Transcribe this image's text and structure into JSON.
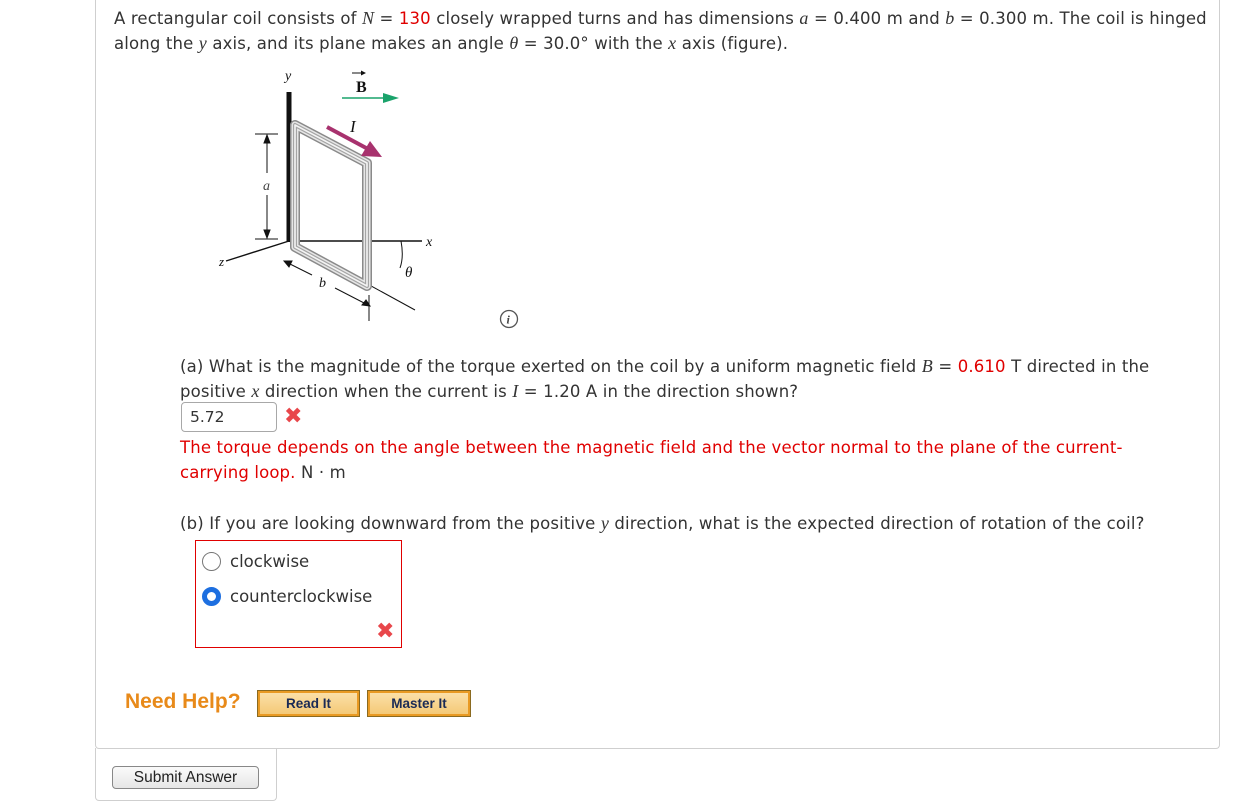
{
  "problem": {
    "intro_1": "A rectangular coil consists of ",
    "N_var": "N",
    "eq": " = ",
    "N_value": "130",
    "intro_2": " closely wrapped turns and has dimensions ",
    "a_var": "a",
    "a_value": " = 0.400 m and ",
    "b_var": "b",
    "b_value": " = 0.300 m. The coil is hinged",
    "intro_3": "along the ",
    "y_var": "y",
    "intro_4": " axis, and its plane makes an angle ",
    "theta_var": "θ",
    "theta_value": " = 30.0° with the ",
    "x_var": "x",
    "intro_5": " axis (figure)."
  },
  "figure": {
    "label_y": "y",
    "label_B": "B",
    "label_I": "I",
    "label_a": "a",
    "label_z": "z",
    "label_b": "b",
    "label_x": "x",
    "label_theta": "θ",
    "info_icon": "info-icon"
  },
  "part_a": {
    "q1": "(a) What is the magnitude of the torque exerted on the coil by a uniform magnetic field ",
    "B_var": "B",
    "eq": " = ",
    "B_value": "0.610",
    "q2": " T directed in the",
    "q3": "positive ",
    "x_var": "x",
    "q4": " direction when the current is ",
    "I_var": "I",
    "q5": " = 1.20 A in the direction shown?",
    "answer_value": "5.72",
    "result_icon": "x-mark-icon",
    "feedback": "The torque depends on the angle between the magnetic field and the vector normal to the plane of the current-carrying loop.",
    "unit": " N · m"
  },
  "part_b": {
    "q1": "(b) If you are looking downward from the positive ",
    "y_var": "y",
    "q2": " direction, what is the expected direction of rotation of the coil?",
    "options": [
      {
        "label": "clockwise",
        "selected": false
      },
      {
        "label": "counterclockwise",
        "selected": true
      }
    ],
    "result_icon": "x-mark-icon"
  },
  "help": {
    "need_help": "Need Help?",
    "read_it": "Read It",
    "master_it": "Master It"
  },
  "submit_label": "Submit Answer",
  "colors": {
    "highlight": "#e00000",
    "radio_selected": "#1d6fe0",
    "help_orange": "#e88a1a",
    "field_arrow": "#1aa36b",
    "current_arrow": "#a8326e"
  }
}
